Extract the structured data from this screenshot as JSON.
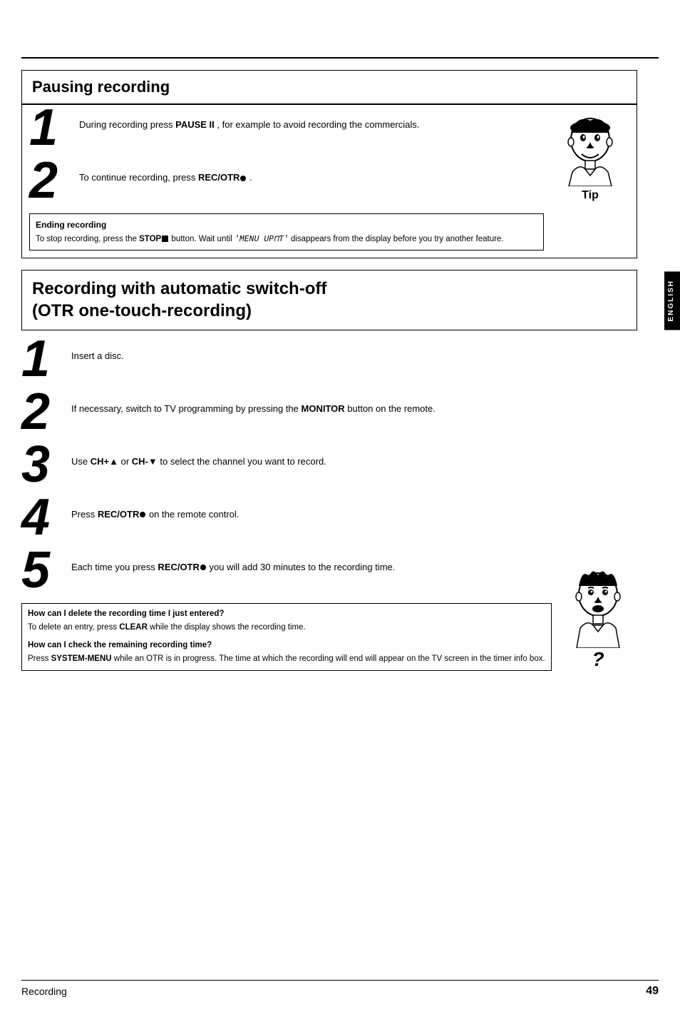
{
  "page": {
    "top_rule_visible": true,
    "side_tab_text": "ENGLISH",
    "footer_left": "Recording",
    "footer_right": "49"
  },
  "pausing_section": {
    "title": "Pausing recording",
    "step1_text_before": "During recording press ",
    "step1_bold": "PAUSE II",
    "step1_text_after": " ,  for example to avoid recording the commercials.",
    "step2_text_before": "To continue recording, press ",
    "step2_bold": "REC/OTR",
    "step2_dot": "●",
    "step2_text_after": " .",
    "tip_box_title": "Ending recording",
    "tip_box_text_before": "To stop recording, press the ",
    "tip_box_bold": "STOP",
    "tip_box_stop": "■",
    "tip_box_text_after": " button. Wait until ",
    "tip_box_italic": "'MENU UP⬦T'",
    "tip_box_text_end": " disappears from the display before you try another feature.",
    "tip_label": "Tip"
  },
  "otr_section": {
    "title_line1": "Recording with automatic switch-off",
    "title_line2": "(OTR one-touch-recording)",
    "step1_text": "Insert a disc.",
    "step2_text_before": "If necessary, switch to TV programming by pressing the ",
    "step2_bold": "MONITOR",
    "step2_text_after": " button on the remote.",
    "step3_text_before": "Use ",
    "step3_bold1": "CH+",
    "step3_arrow_up": "▲",
    "step3_text_mid": " or  ",
    "step3_bold2": "CH-",
    "step3_arrow_down": "▼",
    "step3_text_after": " to select the channel you want to record.",
    "step4_text_before": "Press ",
    "step4_bold": "REC/OTR",
    "step4_dot": "●",
    "step4_text_after": " on the remote control.",
    "step5_text_before": "Each time you press ",
    "step5_bold": "REC/OTR",
    "step5_dot": "●",
    "step5_text_after": " you will add 30 minutes to the recording time.",
    "faq1_title": "How can I delete the recording time I just entered?",
    "faq1_text_before": "To delete an entry, press ",
    "faq1_bold": "CLEAR",
    "faq1_text_after": " while the display shows the recording time.",
    "faq2_title": "How can I check the remaining recording time?",
    "faq2_text_before": "Press ",
    "faq2_bold": "SYSTEM-MENU",
    "faq2_text_after": " while an OTR is in progress. The time at which the recording will end will appear on the TV screen in the timer info box."
  }
}
